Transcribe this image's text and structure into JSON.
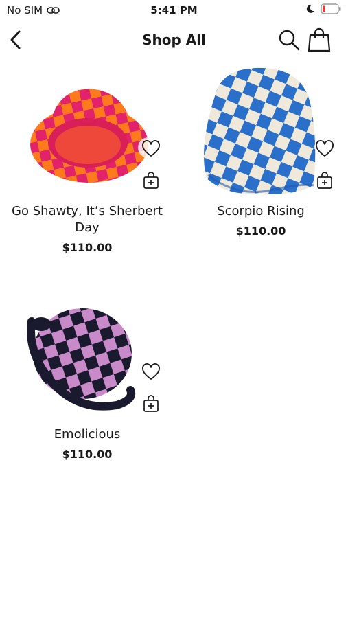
{
  "status": {
    "carrier": "No SIM",
    "time": "5:41 PM"
  },
  "nav": {
    "title": "Shop All"
  },
  "products": [
    {
      "name": "Go Shawty, It’s Sherbert Day",
      "price": "$110.00"
    },
    {
      "name": "Scorpio Rising",
      "price": "$110.00"
    },
    {
      "name": "Emolicious",
      "price": "$110.00"
    }
  ],
  "icons": {
    "back": "chevron-left-icon",
    "search": "search-icon",
    "bag": "shopping-bag-icon",
    "favorite": "heart-icon",
    "add_to_cart": "bag-plus-icon"
  },
  "colors": {
    "battery_low": "#e53935",
    "text": "#1a1a1a"
  }
}
